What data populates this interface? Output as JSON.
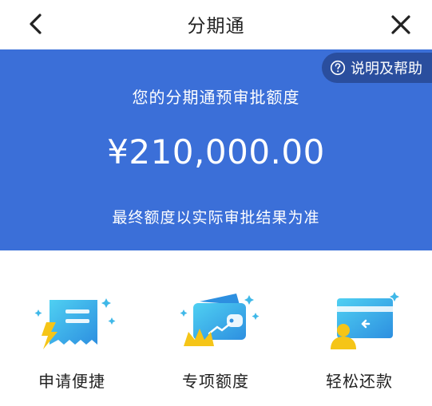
{
  "header": {
    "title": "分期通"
  },
  "banner": {
    "help_label": "说明及帮助",
    "quota_title": "您的分期通预审批额度",
    "quota_amount": "¥210,000.00",
    "quota_note": "最终额度以实际审批结果为准"
  },
  "features": [
    {
      "label": "申请便捷",
      "icon": "receipt-lightning-icon"
    },
    {
      "label": "专项额度",
      "icon": "wallet-crown-icon"
    },
    {
      "label": "轻松还款",
      "icon": "card-user-icon"
    }
  ],
  "colors": {
    "banner_blue": "#3b6fd8",
    "help_pill": "#2a4e9e",
    "accent_yellow": "#f5c518",
    "accent_cyan": "#3fc4ec"
  }
}
